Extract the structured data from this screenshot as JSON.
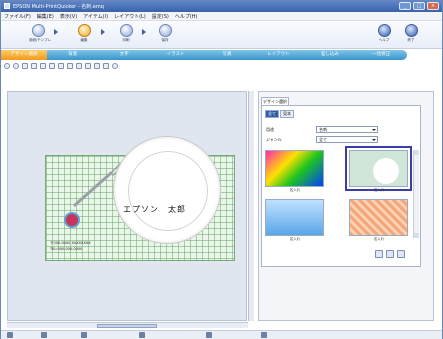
{
  "window": {
    "title": "EPSON Multi-PrintQuicker - 名刺.emq",
    "controls": [
      "_",
      "□",
      "×"
    ]
  },
  "menu": [
    "ファイル(F)",
    "編集(E)",
    "表示(V)",
    "アイテム(I)",
    "レイアウト(L)",
    "設定(S)",
    "ヘルプ(H)"
  ],
  "steps": [
    {
      "label": "用紙/テンプレ"
    },
    {
      "label": "編集"
    },
    {
      "label": "印刷"
    },
    {
      "label": "保存"
    }
  ],
  "right_steps": [
    {
      "label": "ヘルプ"
    },
    {
      "label": "終了"
    }
  ],
  "tabs": [
    "デザイン選択",
    "背景",
    "文字",
    "イラスト",
    "写真",
    "レイアウト",
    "差し込み",
    "一括修正"
  ],
  "card": {
    "name": "エプソン　太郎",
    "line1": "〒000-0000 XXXXXXXX",
    "line2": "TEL:000-000-0000"
  },
  "panel": {
    "tab": "デザイン選択",
    "mini_tabs": [
      "全て",
      "見本"
    ],
    "row1_label": "用途",
    "row1_value": "名刺",
    "row2_label": "ジャンル",
    "row2_value": "全て",
    "thumbs": [
      {
        "caption": "名入れ"
      },
      {
        "caption": "名入れ"
      },
      {
        "caption": "名入れ"
      },
      {
        "caption": "名入れ"
      }
    ]
  },
  "colors": {
    "tab_bar": "#3b95c9",
    "active_tab": "#f19a1c",
    "card_grid": "#6eaa6e",
    "accent_circle": "#c9355a"
  }
}
